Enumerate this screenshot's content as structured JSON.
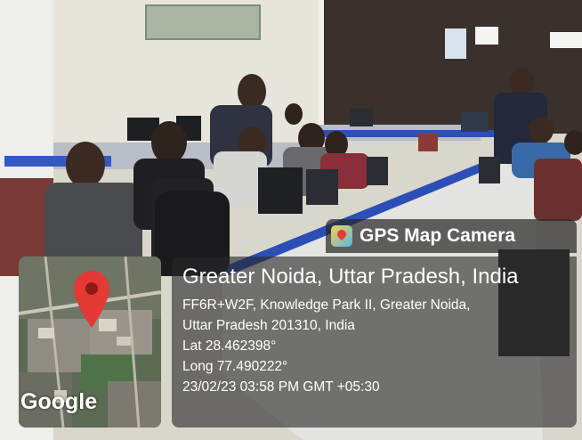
{
  "app": {
    "name": "GPS Map Camera"
  },
  "location": {
    "city_line": "Greater Noida, Uttar Pradesh, India",
    "address_line1": "FF6R+W2F, Knowledge Park II, Greater Noida,",
    "address_line2": "Uttar Pradesh 201310, India",
    "lat": "Lat 28.462398°",
    "long": "Long 77.490222°",
    "datetime": "23/02/23 03:58 PM GMT +05:30"
  },
  "map": {
    "attribution": "Google",
    "pin_color": "#e53935"
  },
  "colors": {
    "overlay": "#282828",
    "pin": "#e53935"
  }
}
